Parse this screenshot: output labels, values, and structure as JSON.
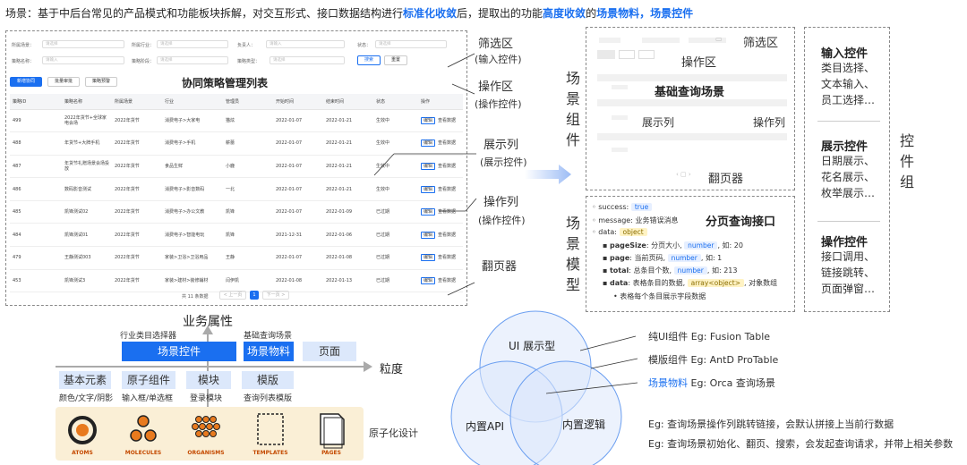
{
  "header": {
    "prefix": "场景：基于中后台常见的产品模式和功能板块拆解，对交互形式、接口数据结构进行",
    "hl1": "标准化收敛",
    "mid": "后，提取出的功能",
    "hl2": "高度收敛",
    "mid2": "的",
    "hl3": "场景物料，场景控件"
  },
  "mock": {
    "filters": [
      {
        "label": "所属场景：",
        "placeholder": "请选择"
      },
      {
        "label": "所属行业：",
        "placeholder": "请选择"
      },
      {
        "label": "负责人：",
        "placeholder": "请输入"
      },
      {
        "label": "状态：",
        "placeholder": "请选择"
      },
      {
        "label": "策略名称：",
        "placeholder": "请输入"
      },
      {
        "label": "策略阶段：",
        "placeholder": "请选择"
      },
      {
        "label": "策略类型：",
        "placeholder": "请选择"
      }
    ],
    "search_btn": "搜索",
    "reset_btn": "重置",
    "action_btns": [
      "新增协同",
      "批量审批",
      "策略预警"
    ],
    "title": "协同策略管理列表",
    "columns": [
      "策略ID",
      "策略名称",
      "所属场景",
      "行业",
      "管理员",
      "开始时间",
      "结束时间",
      "状态",
      "操作"
    ],
    "rows": [
      [
        "499",
        "2022年货节+全球家电会场",
        "2022年货节",
        "消费电子>大家电",
        "猫炫",
        "2022-01-07",
        "2022-01-21",
        "生效中"
      ],
      [
        "488",
        "年货节+大牌手机",
        "2022年货节",
        "消费电子>手机",
        "薪蕾",
        "2022-01-07",
        "2022-01-21",
        "生效中"
      ],
      [
        "487",
        "年货节礼赠场景会场投放",
        "2022年货节",
        "食品生鲜",
        "小鹿",
        "2022-01-07",
        "2022-01-21",
        "生效中"
      ],
      [
        "486",
        "数码影音测试",
        "2022年货节",
        "消费电子>影音数码",
        "一北",
        "2022-01-07",
        "2022-01-21",
        "生效中"
      ],
      [
        "485",
        "凯锋测试02",
        "2022年货节",
        "消费电子>办公文教",
        "凯锋",
        "2022-01-07",
        "2022-01-09",
        "已过期"
      ],
      [
        "484",
        "凯锋测试01",
        "2022年货节",
        "消费电子>智能电玩",
        "凯锋",
        "2021-12-31",
        "2022-01-06",
        "已过期"
      ],
      [
        "479",
        "王静测试003",
        "2022年货节",
        "家装>卫浴>卫浴用品",
        "王静",
        "2022-01-07",
        "2022-01-08",
        "已过期"
      ],
      [
        "453",
        "凯锋测试3",
        "2022年货节",
        "家装>建材>装修辅材",
        "闫伊凯",
        "2022-01-08",
        "2022-01-13",
        "已过期"
      ]
    ],
    "op_edit": "编辑",
    "op_view": "查看数据",
    "total": "共 11 条数据",
    "prev": "< 上一页",
    "page": "1",
    "next": "下一页 >"
  },
  "annotations": {
    "filter": "筛选区",
    "filter_sub": "(输入控件)",
    "action": "操作区",
    "action_sub": "(操作控件)",
    "display": "展示列",
    "display_sub": "(展示控件)",
    "opcol": "操作列",
    "opcol_sub": "(操作控件)",
    "pager": "翻页器"
  },
  "scene_component": {
    "vlabel": "场景组件",
    "filter": "筛选区",
    "action": "操作区",
    "title": "基础查询场景",
    "display": "展示列",
    "opcol": "操作列",
    "pager": "翻页器"
  },
  "scene_model": {
    "vlabel": "场景模型",
    "title": "分页查询接口",
    "success_k": "success:",
    "success_v": "true",
    "message_k": "message:",
    "message_v": "业务错误消息",
    "data_k": "data:",
    "data_v": "object",
    "items": [
      {
        "k": "pageSize",
        "d": ": 分页大小,",
        "t": "number",
        "e": ", 如: 20"
      },
      {
        "k": "page",
        "d": ": 当前页码,",
        "t": "number",
        "e": ", 如: 1"
      },
      {
        "k": "total",
        "d": ": 总条目个数,",
        "t": "number",
        "e": ", 如: 213"
      },
      {
        "k": "data",
        "d": ": 表格条目的数据,",
        "t": "array<object>",
        "e": ", 对象数组"
      }
    ],
    "sub_item": "表格每个条目展示字段数据"
  },
  "controls": {
    "vlabel": "控件组",
    "groups": [
      {
        "title": "输入控件",
        "lines": [
          "类目选择、",
          "文本输入、",
          "员工选择…"
        ]
      },
      {
        "title": "展示控件",
        "lines": [
          "日期展示、",
          "花名展示、",
          "枚举展示…"
        ]
      },
      {
        "title": "操作控件",
        "lines": [
          "接口调用、",
          "链接跳转、",
          "页面弹窗…"
        ]
      }
    ]
  },
  "axis": {
    "y_label": "业务属性",
    "x_label": "粒度",
    "top_note1": "行业类目选择器",
    "top_note2": "基础查询场景",
    "box_ctrl": "场景控件",
    "box_mat": "场景物料",
    "box_page": "页面",
    "box_elem": "基本元素",
    "box_atom": "原子组件",
    "box_block": "模块",
    "box_tpl": "模版",
    "sub_elem": "颜色/文字/阴影",
    "sub_atom": "输入框/单选框",
    "sub_block": "登录模块",
    "sub_tpl": "查询列表模版",
    "atomic_labels": [
      "ATOMS",
      "MOLECULES",
      "ORGANISMS",
      "TEMPLATES",
      "PAGES"
    ],
    "atomic_design": "原子化设计"
  },
  "venn": {
    "top": "UI 展示型",
    "left": "内置API",
    "right": "内置逻辑",
    "note1": "纯UI组件 Eg: Fusion Table",
    "note2": "模版组件 Eg: AntD ProTable",
    "note3_hl": "场景物料",
    "note3": " Eg: Orca 查询场景",
    "eg1": "Eg: 查询场景操作列跳转链接，会默认拼接上当前行数据",
    "eg2": "Eg: 查询场景初始化、翻页、搜索，会发起查询请求，并带上相关参数"
  },
  "colors": {
    "accent": "#1a6ff0",
    "light_blue": "#dce8fb",
    "atom_bg": "#faefd6"
  }
}
